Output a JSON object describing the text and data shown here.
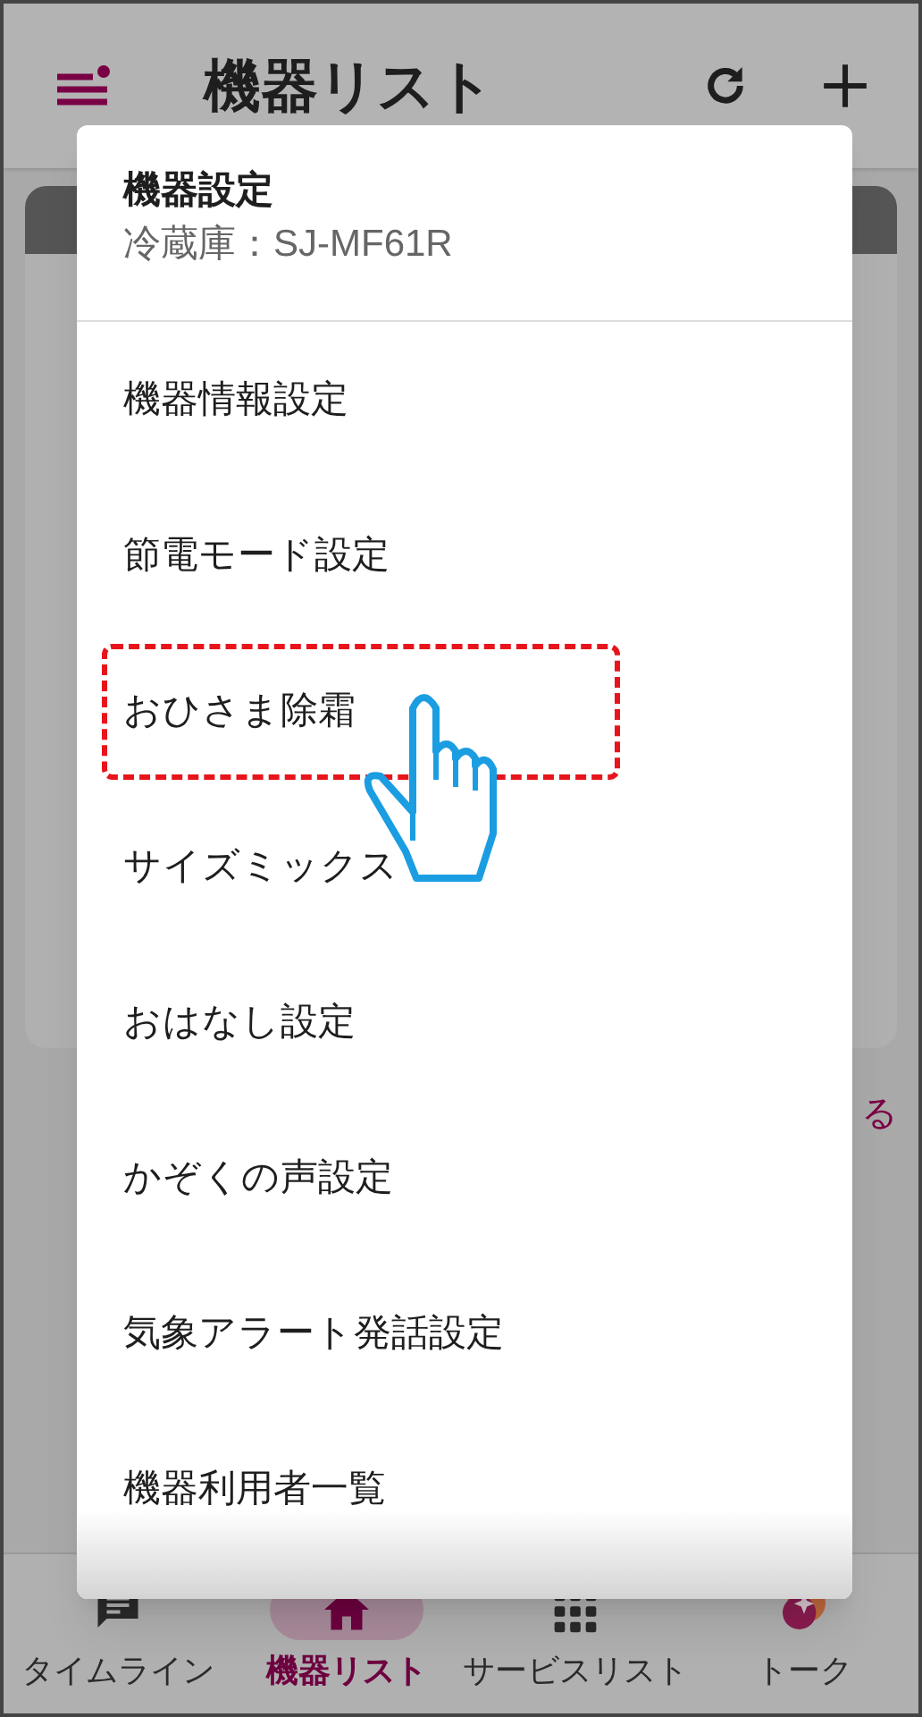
{
  "app_bar": {
    "title": "機器リスト"
  },
  "background": {
    "link_fragment": "る"
  },
  "menu": {
    "title": "機器設定",
    "subtitle": "冷蔵庫：SJ-MF61R",
    "items": [
      {
        "label": "機器情報設定",
        "highlighted": false
      },
      {
        "label": "節電モード設定",
        "highlighted": false
      },
      {
        "label": "おひさま除霜",
        "highlighted": true
      },
      {
        "label": "サイズミックス",
        "highlighted": false
      },
      {
        "label": "おはなし設定",
        "highlighted": false
      },
      {
        "label": "かぞくの声設定",
        "highlighted": false
      },
      {
        "label": "気象アラート発話設定",
        "highlighted": false
      },
      {
        "label": "機器利用者一覧",
        "highlighted": false
      }
    ]
  },
  "bottom_nav": [
    {
      "label": "タイムライン",
      "selected": false
    },
    {
      "label": "機器リスト",
      "selected": true
    },
    {
      "label": "サービスリスト",
      "selected": false
    },
    {
      "label": "トーク",
      "selected": false
    }
  ]
}
